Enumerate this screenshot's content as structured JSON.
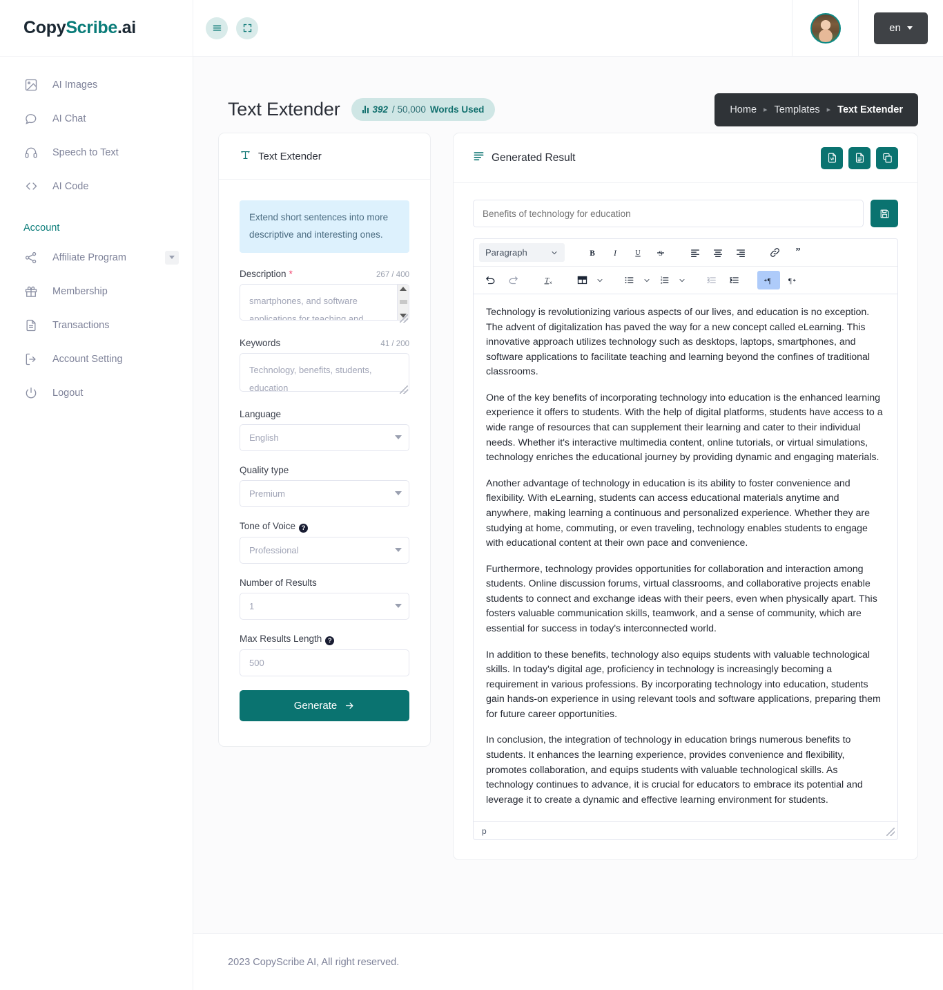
{
  "brand": {
    "part1": "Copy",
    "part2": "Scribe",
    "part3": ".ai"
  },
  "sidebar": {
    "items": [
      {
        "label": "AI Images",
        "icon": "image-icon"
      },
      {
        "label": "AI Chat",
        "icon": "chat-bubble-icon"
      },
      {
        "label": "Speech to Text",
        "icon": "headphones-icon"
      },
      {
        "label": "AI Code",
        "icon": "code-brackets-icon"
      }
    ],
    "section_label": "Account",
    "account_items": [
      {
        "label": "Affiliate Program",
        "icon": "share-nodes-icon"
      },
      {
        "label": "Membership",
        "icon": "gift-icon"
      },
      {
        "label": "Transactions",
        "icon": "document-icon"
      },
      {
        "label": "Account Setting",
        "icon": "sign-out-icon"
      },
      {
        "label": "Logout",
        "icon": "power-icon"
      }
    ]
  },
  "topbar": {
    "menu_icon": "hamburger-icon",
    "fullscreen_icon": "expand-icon",
    "language": "en"
  },
  "page": {
    "title": "Text Extender",
    "words_used_current": "392",
    "words_used_total": "/ 50,000",
    "words_used_label": "Words Used",
    "breadcrumb": [
      "Home",
      "Templates",
      "Text Extender"
    ]
  },
  "form": {
    "panel_title": "Text Extender",
    "panel_icon": "text-format-icon",
    "hint": "Extend short sentences into more descriptive and interesting ones.",
    "description": {
      "label": "Description",
      "required": true,
      "counter": "267 / 400",
      "value": "smartphones, and software applications for teaching and learning"
    },
    "keywords": {
      "label": "Keywords",
      "counter": "41 / 200",
      "value": "Technology, benefits, students, education"
    },
    "language": {
      "label": "Language",
      "value": "English"
    },
    "quality_type": {
      "label": "Quality type",
      "value": "Premium"
    },
    "tone_of_voice": {
      "label": "Tone of Voice",
      "value": "Professional",
      "has_help": true
    },
    "number_of_results": {
      "label": "Number of Results",
      "value": "1"
    },
    "max_results_length": {
      "label": "Max Results Length",
      "value": "500",
      "has_help": true
    },
    "generate_label": "Generate"
  },
  "result": {
    "panel_title": "Generated Result",
    "panel_icon": "list-lines-icon",
    "actions": [
      {
        "name": "export-word-button",
        "icon": "word-file-icon"
      },
      {
        "name": "export-document-button",
        "icon": "text-file-icon"
      },
      {
        "name": "copy-button",
        "icon": "copy-icon"
      }
    ],
    "title_value": "Benefits of technology for education",
    "title_placeholder": "Benefits of technology for education",
    "save_icon": "floppy-disk-icon",
    "toolbar": {
      "format_select": "Paragraph",
      "row1": [
        {
          "name": "bold-button",
          "label": "B"
        },
        {
          "name": "italic-button",
          "label": "I"
        },
        {
          "name": "underline-button",
          "label": "U"
        },
        {
          "name": "strikethrough-button",
          "label": "S"
        },
        {
          "name": "align-left-button",
          "label": ""
        },
        {
          "name": "align-center-button",
          "label": ""
        },
        {
          "name": "align-right-button",
          "label": ""
        },
        {
          "name": "link-button",
          "label": ""
        },
        {
          "name": "blockquote-button",
          "label": ""
        }
      ],
      "row2": [
        {
          "name": "undo-button"
        },
        {
          "name": "redo-button"
        },
        {
          "name": "clear-formatting-button"
        },
        {
          "name": "table-button"
        },
        {
          "name": "bullet-list-button"
        },
        {
          "name": "numbered-list-button"
        },
        {
          "name": "outdent-button"
        },
        {
          "name": "indent-button"
        },
        {
          "name": "ltr-direction-button"
        },
        {
          "name": "rtl-direction-button"
        }
      ]
    },
    "paragraphs": [
      "Technology is revolutionizing various aspects of our lives, and education is no exception. The advent of digitalization has paved the way for a new concept called eLearning. This innovative approach utilizes technology such as desktops, laptops, smartphones, and software applications to facilitate teaching and learning beyond the confines of traditional classrooms.",
      "One of the key benefits of incorporating technology into education is the enhanced learning experience it offers to students. With the help of digital platforms, students have access to a wide range of resources that can supplement their learning and cater to their individual needs. Whether it's interactive multimedia content, online tutorials, or virtual simulations, technology enriches the educational journey by providing dynamic and engaging materials.",
      "Another advantage of technology in education is its ability to foster convenience and flexibility. With eLearning, students can access educational materials anytime and anywhere, making learning a continuous and personalized experience. Whether they are studying at home, commuting, or even traveling, technology enables students to engage with educational content at their own pace and convenience.",
      "Furthermore, technology provides opportunities for collaboration and interaction among students. Online discussion forums, virtual classrooms, and collaborative projects enable students to connect and exchange ideas with their peers, even when physically apart. This fosters valuable communication skills, teamwork, and a sense of community, which are essential for success in today's interconnected world.",
      "In addition to these benefits, technology also equips students with valuable technological skills. In today's digital age, proficiency in technology is increasingly becoming a requirement in various professions. By incorporating technology into education, students gain hands-on experience in using relevant tools and software applications, preparing them for future career opportunities.",
      "In conclusion, the integration of technology in education brings numerous benefits to students. It enhances the learning experience, provides convenience and flexibility, promotes collaboration, and equips students with valuable technological skills. As technology continues to advance, it is crucial for educators to embrace its potential and leverage it to create a dynamic and effective learning environment for students."
    ],
    "status_path": "p"
  },
  "footer": {
    "text": "2023 CopyScribe AI, All right reserved."
  },
  "colors": {
    "accent": "#0a7370",
    "accent_light": "#cfe6e5",
    "dark": "#2f3337",
    "hint_bg": "#ddf1fd",
    "required": "#f1416c"
  }
}
